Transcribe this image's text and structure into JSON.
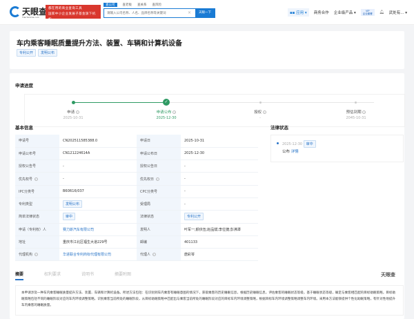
{
  "header": {
    "logo_text": "天眼查",
    "logo_sub": "TianYanCha.com",
    "ad_line1": "都在用的商业查询工具",
    "ad_line2": "国家中小企业发展子基金旗下机构",
    "search_tabs": [
      "查公司",
      "查老板",
      "查关系",
      "查风险"
    ],
    "search_placeholder": "请输入公司名称、人名、品牌名称等关键词",
    "search_button": "天眼一下",
    "nav": {
      "app": "应用",
      "business": "商务合作",
      "enterprise": "企业级产品",
      "vip_line1": "VIP",
      "vip_line2": "企业套餐",
      "user": "武处有..."
    }
  },
  "title": "车内乘客睡眠质量提升方法、装置、车辆和计算机设备",
  "title_tags": [
    "专利公开",
    "发明公布"
  ],
  "progress": {
    "heading": "申请进度",
    "steps": [
      {
        "label": "申请",
        "date": "2025-10-31"
      },
      {
        "label": "申请公布",
        "date": "2025-12-30"
      },
      {
        "label": "授权",
        "date": "-"
      },
      {
        "label": "预估到期",
        "date": "2045-10-31"
      }
    ]
  },
  "basic": {
    "heading": "基本信息",
    "rows": [
      [
        "申请号",
        "CN202511585388.0",
        "申请日",
        "2025-10-31"
      ],
      [
        "申请公布号",
        "CN121224614A",
        "申请公布日",
        "2025-12-30"
      ],
      [
        "授权公告号",
        "-",
        "授权公告日",
        "-"
      ],
      [
        "优先权号",
        "-",
        "优先权日",
        "-"
      ],
      [
        "IPC分类号",
        "B60R16/037",
        "CPC分类号",
        "-"
      ],
      [
        "专利类型",
        "发明公布",
        "受理局",
        "-"
      ],
      [
        "简单法律状态",
        "审中",
        "法律状态",
        "专利公开"
      ],
      [
        "申请（专利权）人",
        "赛力斯汽车有限公司",
        "发明人",
        "叶军一;颜伏伍;赵品斌;李位捷;彭沸潭"
      ],
      [
        "地址",
        "重庆市江北区福生大道229号",
        "邮编",
        "401133"
      ],
      [
        "代理机构",
        "华进联合专利商标代理有限公司",
        "代理人",
        "唐彩琴"
      ]
    ]
  },
  "legal": {
    "heading": "法律状态",
    "date": "2025-12-30",
    "badge": "审中",
    "event": "公布",
    "detail": "详情"
  },
  "tabs": [
    "摘要",
    "权利要求",
    "说明书",
    "摘要附图"
  ],
  "watermark": "天眼查",
  "abstract": "本申请涉及一种车内乘客睡眠质量提升方法、装置、车辆和计算机设备。所述方法包括：在识别到车内乘客有睡眠意图的情况下，获取乘客的历史睡眠信息，根据历史睡眠信息，评估乘客的睡眠状态等级，基于睡眠状态等级，确定与乘客相匹配的目标助眠策略，目标助眠策略包括不同的睡眠阶段对应的车内环境调整策略，识别乘客当前所处的睡眠阶段，从目标助眠策略中匹配出与乘客当前所处的睡眠阶段对应的目标车内环境调整策略，根据目标车内环境调整策略调整车内环境。采用本方法能够提供个性化助眠策略，有针对性地提升车内乘客的睡眠质量。"
}
